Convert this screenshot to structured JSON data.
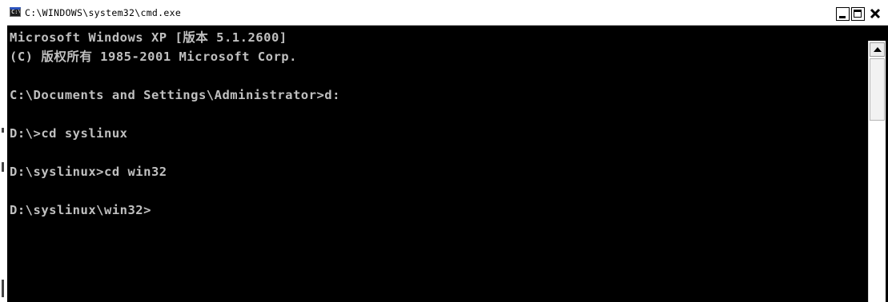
{
  "window": {
    "title": "C:\\WINDOWS\\system32\\cmd.exe",
    "icon": "cmd-console-icon",
    "controls": [
      "minimize-icon",
      "maximize-icon",
      "close-icon"
    ]
  },
  "console": {
    "lines": [
      "Microsoft Windows XP [版本 5.1.2600]",
      "(C) 版权所有 1985-2001 Microsoft Corp.",
      "",
      "C:\\Documents and Settings\\Administrator>d:",
      "",
      "D:\\>cd syslinux",
      "",
      "D:\\syslinux>cd win32",
      "",
      "D:\\syslinux\\win32>"
    ]
  },
  "colors": {
    "console_background": "#000000",
    "console_text": "#c0c0c0",
    "titlebar_background": "#ffffff"
  }
}
